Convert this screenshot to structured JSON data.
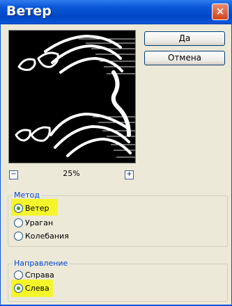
{
  "window": {
    "title": "Ветер",
    "close_glyph": "×"
  },
  "buttons": {
    "ok_label": "Да",
    "cancel_label": "Отмена"
  },
  "zoom": {
    "minus_glyph": "−",
    "plus_glyph": "+",
    "level": "25%"
  },
  "method": {
    "legend": "Метод",
    "options": [
      {
        "label": "Ветер",
        "checked": true
      },
      {
        "label": "Ураган",
        "checked": false
      },
      {
        "label": "Колебания",
        "checked": false
      }
    ]
  },
  "direction": {
    "legend": "Направление",
    "options": [
      {
        "label": "Справа",
        "checked": false
      },
      {
        "label": "Слева",
        "checked": true
      }
    ]
  },
  "colors": {
    "highlight": "#f5f52c",
    "titlebar": "#0a55d8",
    "radio_dot": "#21a121"
  }
}
